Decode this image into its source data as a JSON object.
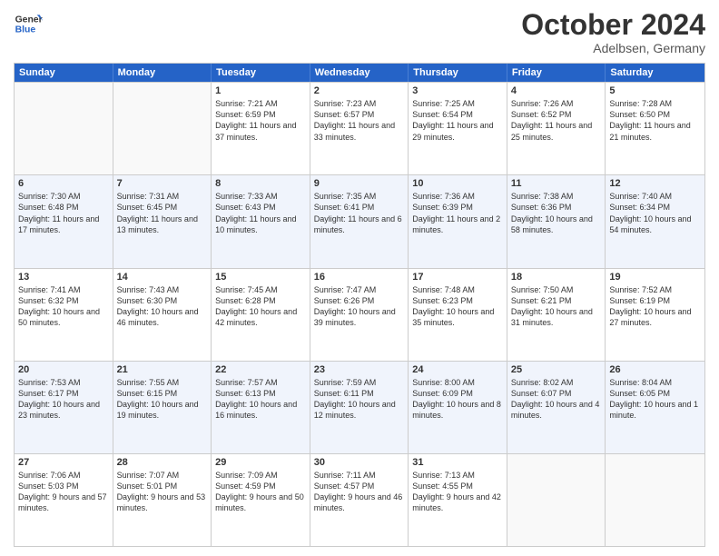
{
  "header": {
    "logo_line1": "General",
    "logo_line2": "Blue",
    "month": "October 2024",
    "location": "Adelbsen, Germany"
  },
  "weekdays": [
    "Sunday",
    "Monday",
    "Tuesday",
    "Wednesday",
    "Thursday",
    "Friday",
    "Saturday"
  ],
  "rows": [
    [
      {
        "day": "",
        "content": ""
      },
      {
        "day": "",
        "content": ""
      },
      {
        "day": "1",
        "content": "Sunrise: 7:21 AM\nSunset: 6:59 PM\nDaylight: 11 hours and 37 minutes."
      },
      {
        "day": "2",
        "content": "Sunrise: 7:23 AM\nSunset: 6:57 PM\nDaylight: 11 hours and 33 minutes."
      },
      {
        "day": "3",
        "content": "Sunrise: 7:25 AM\nSunset: 6:54 PM\nDaylight: 11 hours and 29 minutes."
      },
      {
        "day": "4",
        "content": "Sunrise: 7:26 AM\nSunset: 6:52 PM\nDaylight: 11 hours and 25 minutes."
      },
      {
        "day": "5",
        "content": "Sunrise: 7:28 AM\nSunset: 6:50 PM\nDaylight: 11 hours and 21 minutes."
      }
    ],
    [
      {
        "day": "6",
        "content": "Sunrise: 7:30 AM\nSunset: 6:48 PM\nDaylight: 11 hours and 17 minutes."
      },
      {
        "day": "7",
        "content": "Sunrise: 7:31 AM\nSunset: 6:45 PM\nDaylight: 11 hours and 13 minutes."
      },
      {
        "day": "8",
        "content": "Sunrise: 7:33 AM\nSunset: 6:43 PM\nDaylight: 11 hours and 10 minutes."
      },
      {
        "day": "9",
        "content": "Sunrise: 7:35 AM\nSunset: 6:41 PM\nDaylight: 11 hours and 6 minutes."
      },
      {
        "day": "10",
        "content": "Sunrise: 7:36 AM\nSunset: 6:39 PM\nDaylight: 11 hours and 2 minutes."
      },
      {
        "day": "11",
        "content": "Sunrise: 7:38 AM\nSunset: 6:36 PM\nDaylight: 10 hours and 58 minutes."
      },
      {
        "day": "12",
        "content": "Sunrise: 7:40 AM\nSunset: 6:34 PM\nDaylight: 10 hours and 54 minutes."
      }
    ],
    [
      {
        "day": "13",
        "content": "Sunrise: 7:41 AM\nSunset: 6:32 PM\nDaylight: 10 hours and 50 minutes."
      },
      {
        "day": "14",
        "content": "Sunrise: 7:43 AM\nSunset: 6:30 PM\nDaylight: 10 hours and 46 minutes."
      },
      {
        "day": "15",
        "content": "Sunrise: 7:45 AM\nSunset: 6:28 PM\nDaylight: 10 hours and 42 minutes."
      },
      {
        "day": "16",
        "content": "Sunrise: 7:47 AM\nSunset: 6:26 PM\nDaylight: 10 hours and 39 minutes."
      },
      {
        "day": "17",
        "content": "Sunrise: 7:48 AM\nSunset: 6:23 PM\nDaylight: 10 hours and 35 minutes."
      },
      {
        "day": "18",
        "content": "Sunrise: 7:50 AM\nSunset: 6:21 PM\nDaylight: 10 hours and 31 minutes."
      },
      {
        "day": "19",
        "content": "Sunrise: 7:52 AM\nSunset: 6:19 PM\nDaylight: 10 hours and 27 minutes."
      }
    ],
    [
      {
        "day": "20",
        "content": "Sunrise: 7:53 AM\nSunset: 6:17 PM\nDaylight: 10 hours and 23 minutes."
      },
      {
        "day": "21",
        "content": "Sunrise: 7:55 AM\nSunset: 6:15 PM\nDaylight: 10 hours and 19 minutes."
      },
      {
        "day": "22",
        "content": "Sunrise: 7:57 AM\nSunset: 6:13 PM\nDaylight: 10 hours and 16 minutes."
      },
      {
        "day": "23",
        "content": "Sunrise: 7:59 AM\nSunset: 6:11 PM\nDaylight: 10 hours and 12 minutes."
      },
      {
        "day": "24",
        "content": "Sunrise: 8:00 AM\nSunset: 6:09 PM\nDaylight: 10 hours and 8 minutes."
      },
      {
        "day": "25",
        "content": "Sunrise: 8:02 AM\nSunset: 6:07 PM\nDaylight: 10 hours and 4 minutes."
      },
      {
        "day": "26",
        "content": "Sunrise: 8:04 AM\nSunset: 6:05 PM\nDaylight: 10 hours and 1 minute."
      }
    ],
    [
      {
        "day": "27",
        "content": "Sunrise: 7:06 AM\nSunset: 5:03 PM\nDaylight: 9 hours and 57 minutes."
      },
      {
        "day": "28",
        "content": "Sunrise: 7:07 AM\nSunset: 5:01 PM\nDaylight: 9 hours and 53 minutes."
      },
      {
        "day": "29",
        "content": "Sunrise: 7:09 AM\nSunset: 4:59 PM\nDaylight: 9 hours and 50 minutes."
      },
      {
        "day": "30",
        "content": "Sunrise: 7:11 AM\nSunset: 4:57 PM\nDaylight: 9 hours and 46 minutes."
      },
      {
        "day": "31",
        "content": "Sunrise: 7:13 AM\nSunset: 4:55 PM\nDaylight: 9 hours and 42 minutes."
      },
      {
        "day": "",
        "content": ""
      },
      {
        "day": "",
        "content": ""
      }
    ]
  ]
}
